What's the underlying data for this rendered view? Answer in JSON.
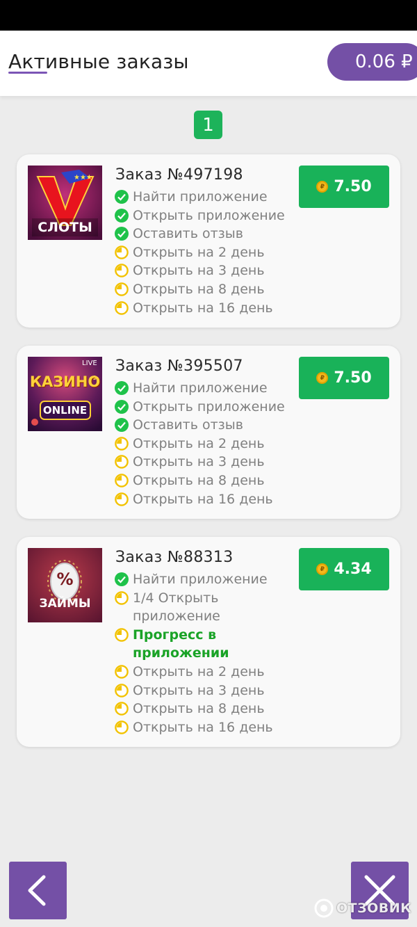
{
  "header": {
    "title": "Активные заказы",
    "balance": "0.06 ₽"
  },
  "pagination": {
    "current_page": "1"
  },
  "orders": [
    {
      "title": "Заказ №497198",
      "reward": "7.50",
      "thumb_label": "СЛОТЫ",
      "tasks": [
        {
          "label": "Найти приложение",
          "status": "done"
        },
        {
          "label": "Открыть приложение",
          "status": "done"
        },
        {
          "label": "Оставить отзыв",
          "status": "done"
        },
        {
          "label": "Открыть на 2 день",
          "status": "pending"
        },
        {
          "label": "Открыть на 3 день",
          "status": "pending"
        },
        {
          "label": "Открыть на 8 день",
          "status": "pending"
        },
        {
          "label": "Открыть на 16 день",
          "status": "pending"
        }
      ]
    },
    {
      "title": "Заказ №395507",
      "reward": "7.50",
      "thumb_label": "КАЗИНО",
      "thumb_sublabel": "ONLINE",
      "thumb_tag": "LIVE",
      "tasks": [
        {
          "label": "Найти приложение",
          "status": "done"
        },
        {
          "label": "Открыть приложение",
          "status": "done"
        },
        {
          "label": "Оставить отзыв",
          "status": "done"
        },
        {
          "label": "Открыть на 2 день",
          "status": "pending"
        },
        {
          "label": "Открыть на 3 день",
          "status": "pending"
        },
        {
          "label": "Открыть на 8 день",
          "status": "pending"
        },
        {
          "label": "Открыть на 16 день",
          "status": "pending"
        }
      ]
    },
    {
      "title": "Заказ №88313",
      "reward": "4.34",
      "thumb_label": "ЗАЙМЫ",
      "thumb_symbol": "%",
      "tasks": [
        {
          "label": "Найти приложение",
          "status": "done"
        },
        {
          "label": "1/4 Открыть приложение",
          "status": "pending"
        },
        {
          "label": "Прогресс в приложении",
          "status": "pending",
          "highlight": true
        },
        {
          "label": "Открыть на 2 день",
          "status": "pending"
        },
        {
          "label": "Открыть на 3 день",
          "status": "pending"
        },
        {
          "label": "Открыть на 8 день",
          "status": "pending"
        },
        {
          "label": "Открыть на 16 день",
          "status": "pending"
        }
      ]
    }
  ],
  "coin_symbol": "₽",
  "watermark": "ОТЗОВИК",
  "icons": {
    "done": "check-circle-icon",
    "pending": "clock-icon",
    "back": "chevron-left-icon",
    "close": "close-icon"
  },
  "colors": {
    "accent": "#7450a6",
    "success": "#19b259",
    "done_icon": "#1fc24a",
    "pending_icon": "#f2c200",
    "highlight_text": "#1aa327"
  }
}
